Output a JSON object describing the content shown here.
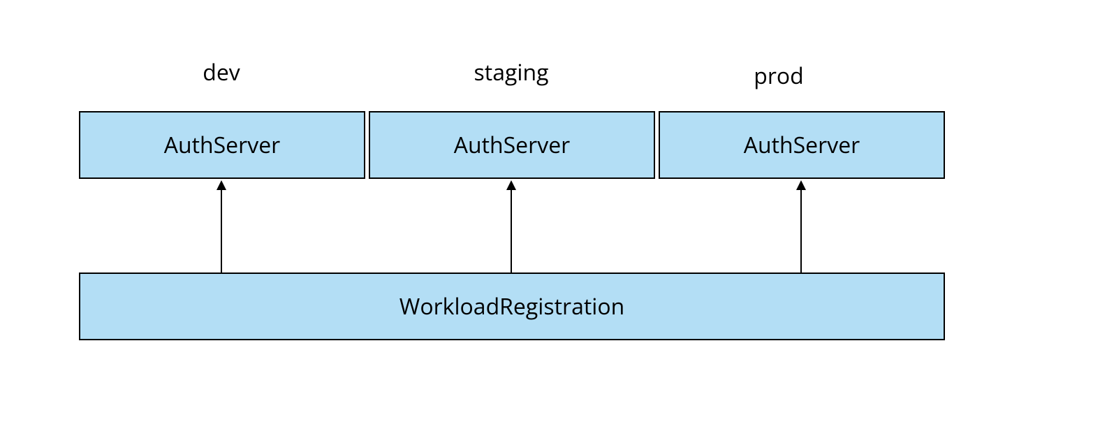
{
  "environments": [
    {
      "label": "dev",
      "box_label": "AuthServer"
    },
    {
      "label": "staging",
      "box_label": "AuthServer"
    },
    {
      "label": "prod",
      "box_label": "AuthServer"
    }
  ],
  "bottom_box_label": "WorkloadRegistration",
  "colors": {
    "box_fill": "#b3def5",
    "box_border": "#000000"
  }
}
